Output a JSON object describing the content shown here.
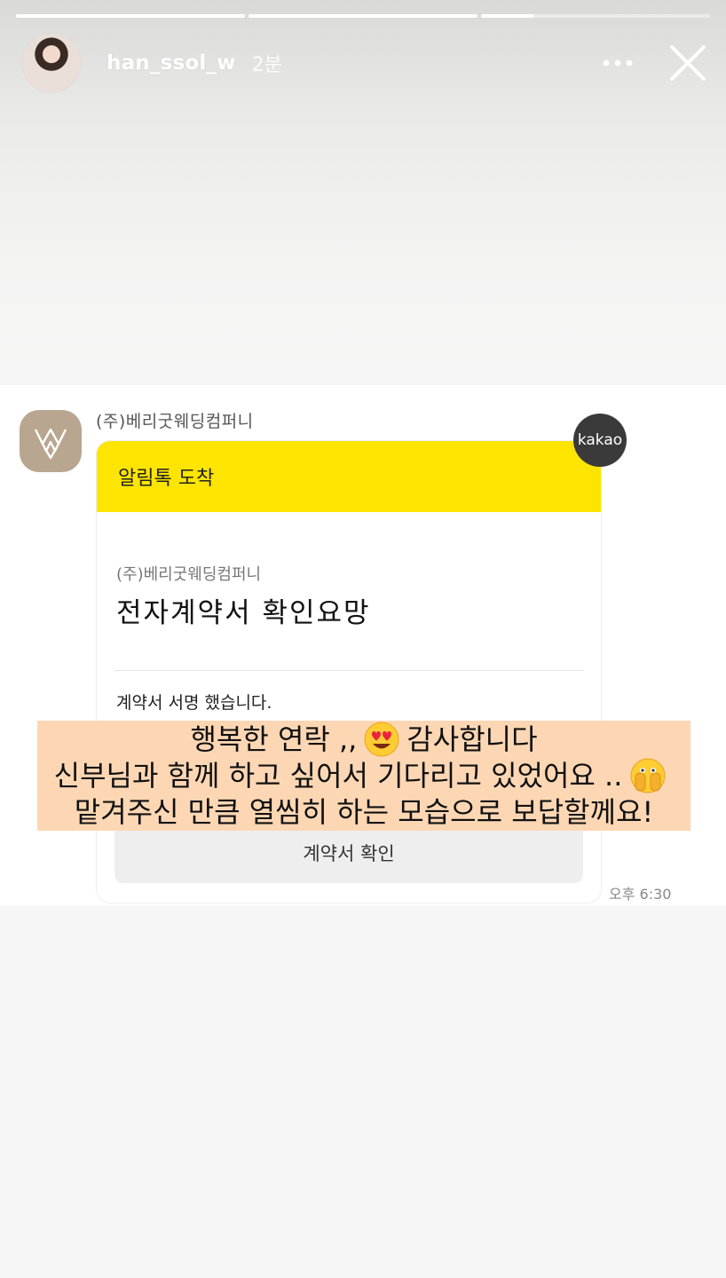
{
  "story": {
    "username": "han_ssol_w",
    "time_ago": "2분",
    "progress": [
      1.0,
      1.0,
      0.23
    ]
  },
  "message": {
    "sender_name": "(주)베리굿웨딩컴퍼니",
    "kakao_label": "kakao",
    "card": {
      "header": "알림톡 도착",
      "subtitle": "(주)베리굿웨딩컴퍼니",
      "title": "전자계약서 확인요망",
      "body": "계약서 서명 했습니다.",
      "button_label": "계약서 확인"
    },
    "time": "오후 6:30"
  },
  "caption": {
    "line1a": "행복한 연락 ,,",
    "line1_emoji": "heart-eyes-emoji-icon",
    "line1b": "감사합니다",
    "line2": "신부님과 함께 하고 싶어서 기다리고 있었어요 ..",
    "line2_emoji": "hands-over-face-emoji-icon",
    "line3": "맡겨주신 만큼 열씸히 하는 모습으로 보답할께요!"
  },
  "colors": {
    "kakao_yellow": "#fee500",
    "caption_bg": "#fdd7b4",
    "brand_tan": "#b9a690"
  }
}
